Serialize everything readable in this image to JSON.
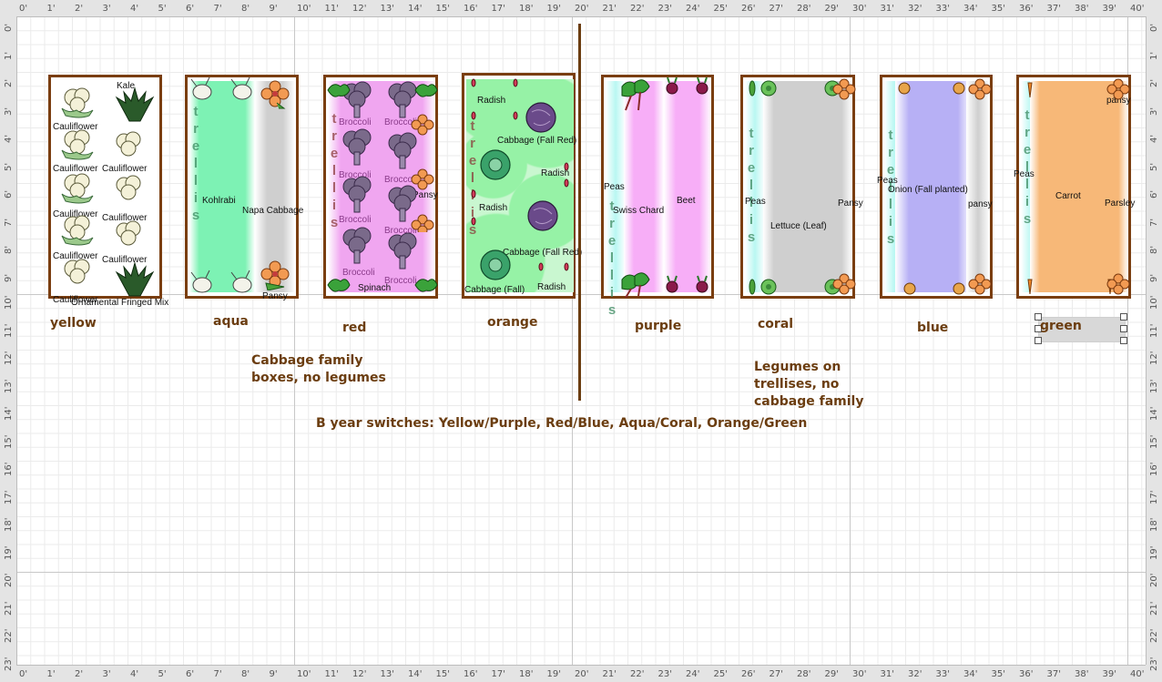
{
  "rulers": {
    "top": [
      "0'",
      "1'",
      "2'",
      "3'",
      "4'",
      "5'",
      "6'",
      "7'",
      "8'",
      "9'",
      "10'",
      "11'",
      "12'",
      "13'",
      "14'",
      "15'",
      "16'",
      "17'",
      "18'",
      "19'",
      "20'",
      "21'",
      "22'",
      "23'",
      "24'",
      "25'",
      "26'",
      "27'",
      "28'",
      "29'",
      "30'",
      "31'",
      "32'",
      "33'",
      "34'",
      "35'",
      "36'",
      "37'",
      "38'",
      "39'",
      "40'"
    ],
    "left": [
      "0'",
      "1'",
      "2'",
      "3'",
      "4'",
      "5'",
      "6'",
      "7'",
      "8'",
      "9'",
      "10'",
      "11'",
      "12'",
      "13'",
      "14'",
      "15'",
      "16'",
      "17'",
      "18'",
      "19'",
      "20'",
      "21'",
      "22'",
      "23'"
    ]
  },
  "beds": {
    "yellow": {
      "label": "yellow",
      "plants": {
        "kale": "Kale",
        "c1": "Cauliflower",
        "c2": "Cauliflower",
        "c3": "Cauliflower",
        "c4": "Cauliflower",
        "c5": "Cauliflower",
        "c6": "Cauliflower",
        "c7": "Cauliflower",
        "c8": "Cauliflower",
        "c9": "Cauliflower",
        "kale2": "Ornamental Fringed Mix"
      }
    },
    "aqua": {
      "label": "aqua",
      "trellis": "trellis",
      "plants": {
        "kohlrabi": "Kohlrabi",
        "napa": "Napa Cabbage",
        "pansy": "Pansy"
      }
    },
    "red": {
      "label": "red",
      "trellis": "trellis",
      "plants": {
        "b1": "Broccoli",
        "b2": "Broccoli",
        "b3": "Broccoli",
        "b4": "Broccoli",
        "b5": "Broccoli",
        "b6": "Broccoli",
        "b7": "Broccoli",
        "b8": "Broccoli",
        "pansy": "Pansy",
        "spinach": "Spinach"
      }
    },
    "orange": {
      "label": "orange",
      "trellis": "trellis",
      "plants": {
        "radish1": "Radish",
        "cabbage_red1": "Cabbage (Fall Red)",
        "radish2": "Radish",
        "radish3": "Radish",
        "cabbage_red2": "Cabbage (Fall Red)",
        "cabbage_fall": "Cabbage (Fall)",
        "radish4": "Radish"
      }
    },
    "purple": {
      "label": "purple",
      "trellis": "trellis",
      "plants": {
        "peas": "Peas",
        "chard": "Swiss Chard",
        "beet": "Beet"
      }
    },
    "coral": {
      "label": "coral",
      "trellis": "trellis",
      "plants": {
        "peas": "Peas",
        "pansy": "Pansy",
        "lettuce": "Lettuce (Leaf)"
      }
    },
    "blue": {
      "label": "blue",
      "trellis": "trellis",
      "plants": {
        "peas": "Peas",
        "onion": "Onion (Fall planted)",
        "pansy": "pansy"
      }
    },
    "green": {
      "label": "green",
      "trellis": "trellis",
      "plants": {
        "pansy": "pansy",
        "peas": "Peas",
        "carrot": "Carrot",
        "parsley": "Parsley"
      }
    }
  },
  "notes": {
    "cabbage": [
      "Cabbage family",
      "boxes, no legumes"
    ],
    "legumes": [
      "Legumes on",
      "trellises, no",
      "cabbage family"
    ],
    "switches": "B year switches: Yellow/Purple, Red/Blue, Aqua/Coral, Orange/Green"
  },
  "colors": {
    "bed_border": "#7a3e10",
    "label": "#6b3d10",
    "aqua_fill": "#7df2b4",
    "red_fill": "#f0a6f0",
    "orange_fill": "#96f2a6",
    "purple_fill": "#f7aef7",
    "cyan_fill": "#b9f7f2",
    "gray_fill": "#cfcfcf",
    "blue_fill": "#b7b0f5",
    "carrot_fill": "#f7b878"
  },
  "icons": [
    "cauliflower-icon",
    "kale-icon",
    "kohlrabi-icon",
    "pansy-icon",
    "broccoli-icon",
    "spinach-icon",
    "radish-icon",
    "red-cabbage-icon",
    "green-cabbage-icon",
    "swiss-chard-icon",
    "beet-icon",
    "pea-icon",
    "lettuce-icon",
    "onion-icon",
    "carrot-icon",
    "parsley-icon"
  ]
}
